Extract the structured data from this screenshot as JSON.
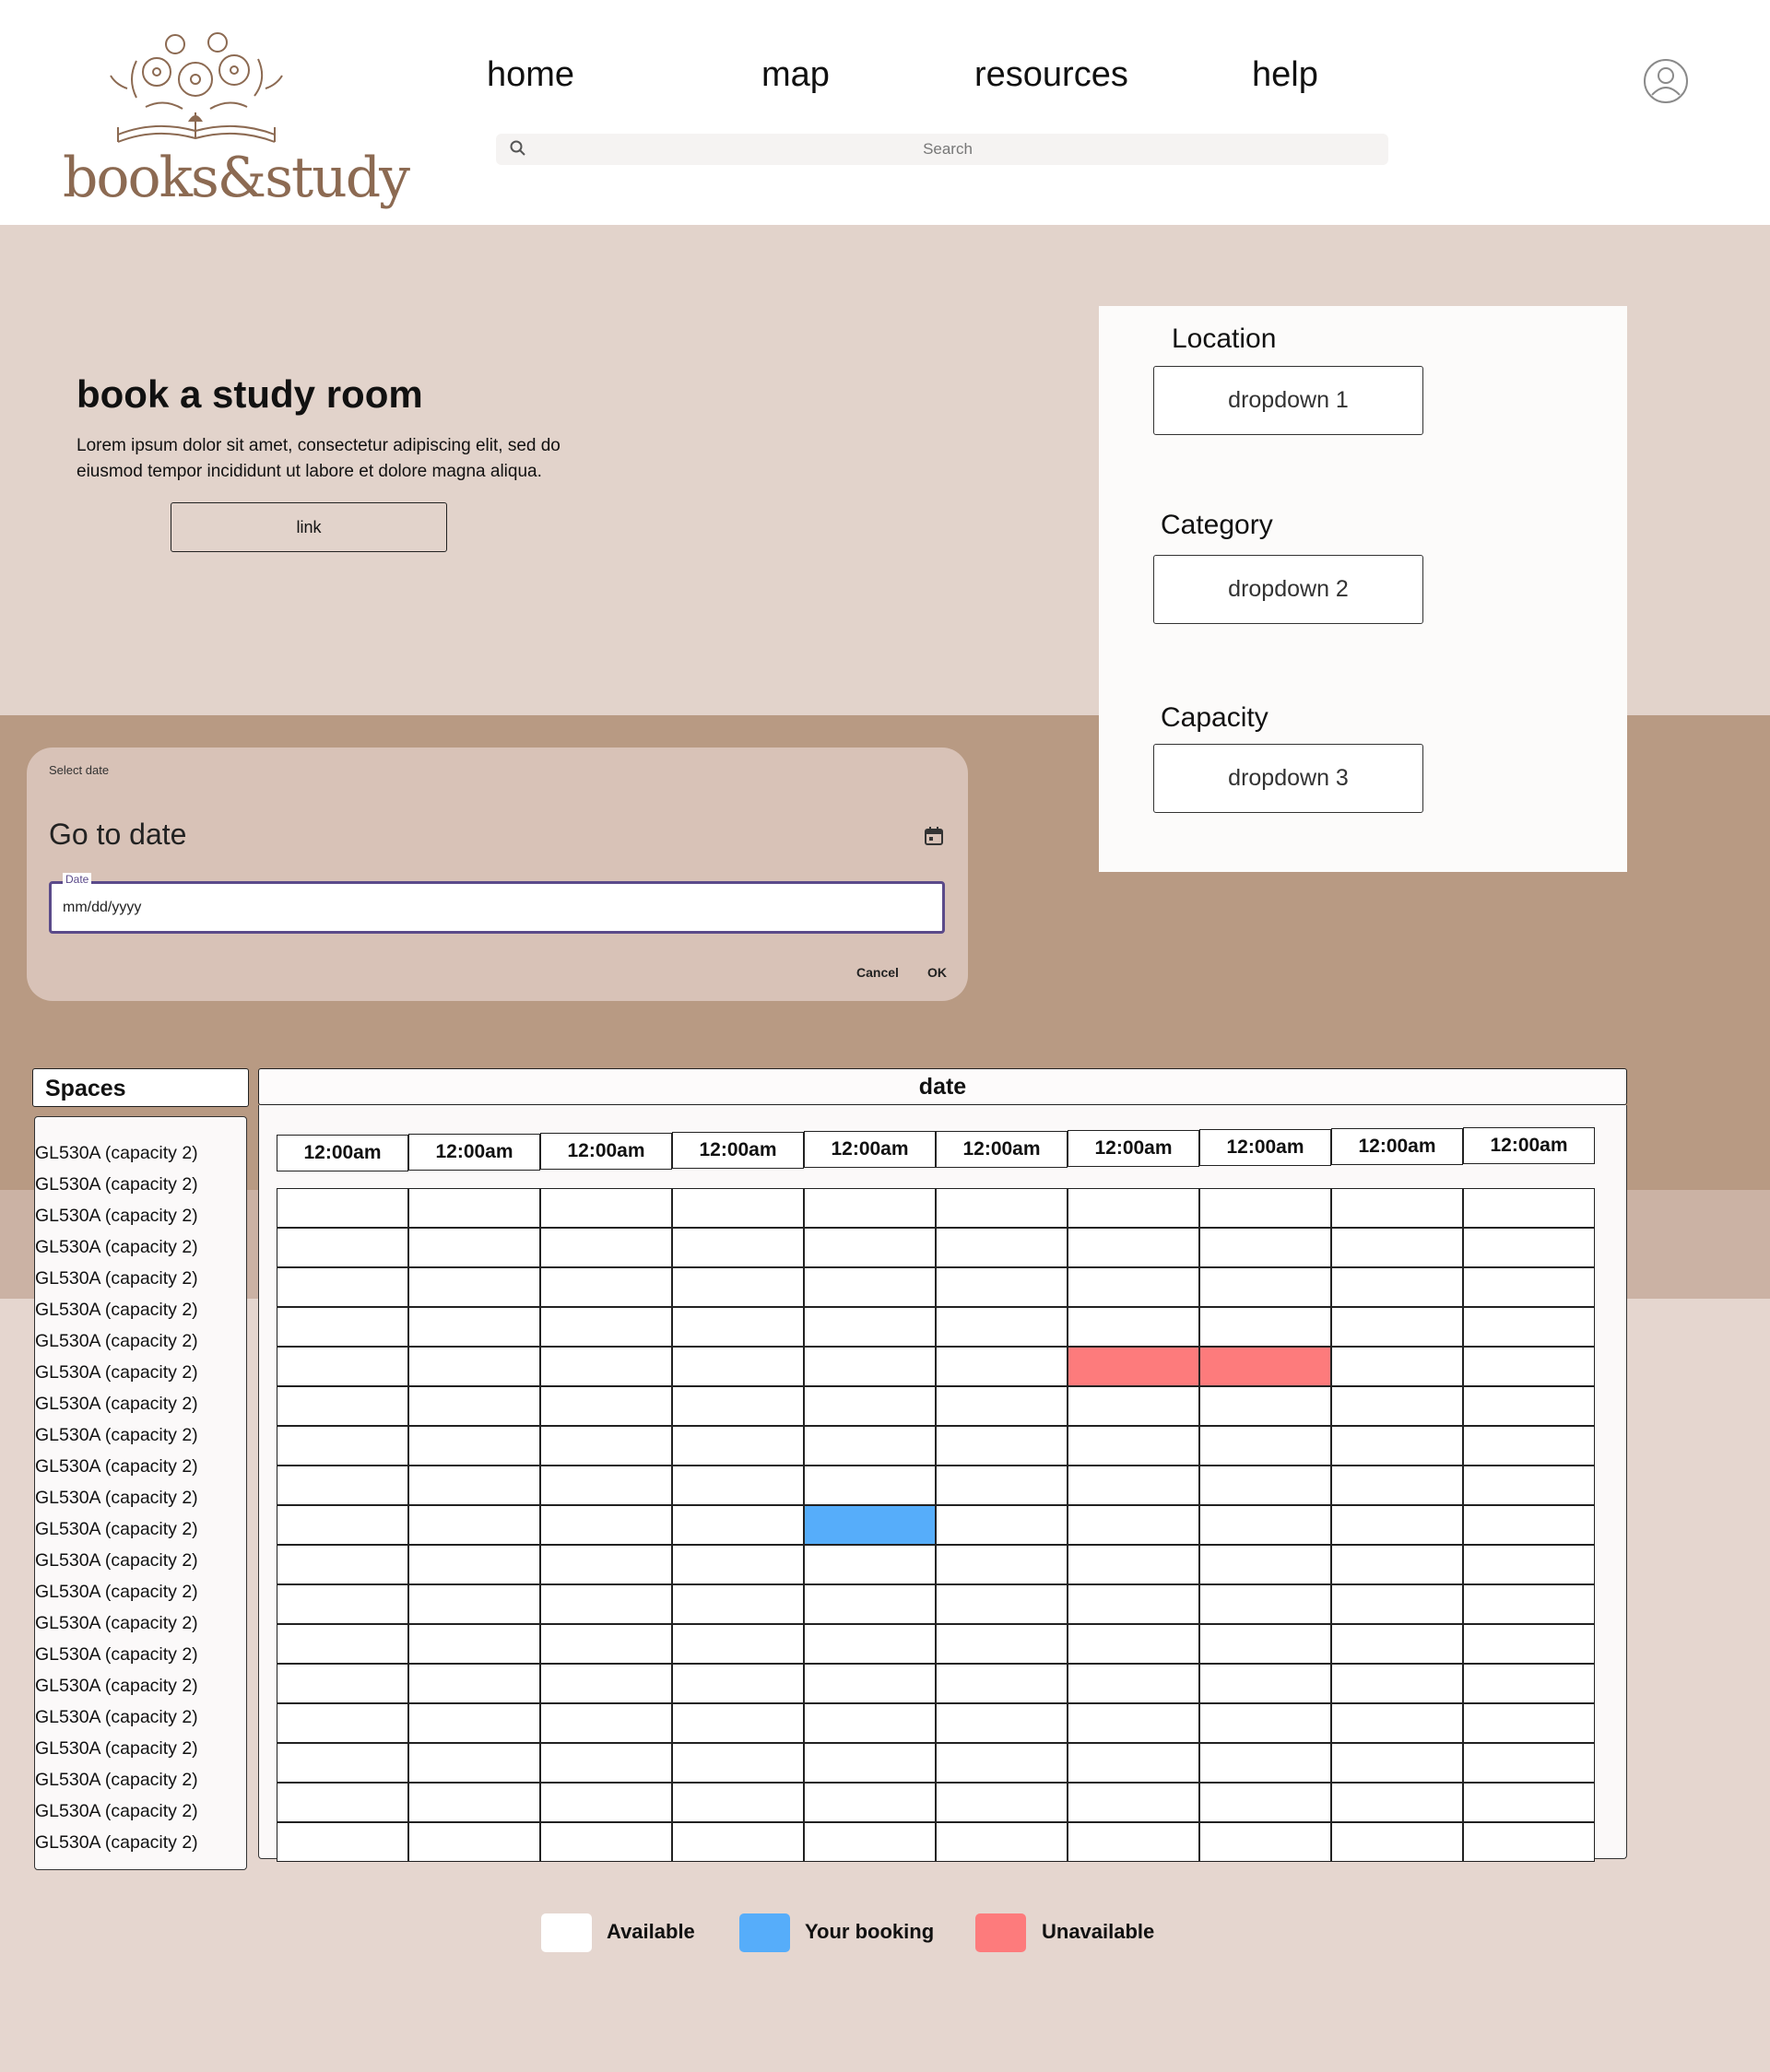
{
  "brand": {
    "name": "books&study"
  },
  "nav": {
    "items": [
      "home",
      "map",
      "resources",
      "help"
    ]
  },
  "search": {
    "placeholder": "Search"
  },
  "hero": {
    "title": "book a study room",
    "body": "Lorem ipsum dolor sit amet, consectetur adipiscing elit, sed do eiusmod tempor incididunt ut labore et dolore magna aliqua.",
    "link_label": "link"
  },
  "filters": {
    "location": {
      "label": "Location",
      "value": "dropdown 1"
    },
    "category": {
      "label": "Category",
      "value": "dropdown 2"
    },
    "capacity": {
      "label": "Capacity",
      "value": "dropdown 3"
    }
  },
  "datepicker": {
    "caption": "Select date",
    "title": "Go to date",
    "field_label": "Date",
    "placeholder": "mm/dd/yyyy",
    "cancel_label": "Cancel",
    "ok_label": "OK"
  },
  "spaces": {
    "header": "Spaces",
    "items": [
      "GL530A (capacity 2)",
      "GL530A (capacity 2)",
      "GL530A (capacity 2)",
      "GL530A (capacity 2)",
      "GL530A (capacity 2)",
      "GL530A (capacity 2)",
      "GL530A (capacity 2)",
      "GL530A (capacity 2)",
      "GL530A (capacity 2)",
      "GL530A (capacity 2)",
      "GL530A (capacity 2)",
      "GL530A (capacity 2)",
      "GL530A (capacity 2)",
      "GL530A (capacity 2)",
      "GL530A (capacity 2)",
      "GL530A (capacity 2)",
      "GL530A (capacity 2)",
      "GL530A (capacity 2)",
      "GL530A (capacity 2)",
      "GL530A (capacity 2)",
      "GL530A (capacity 2)",
      "GL530A (capacity 2)",
      "GL530A (capacity 2)"
    ]
  },
  "schedule": {
    "date_header": "date",
    "time_slots": [
      "12:00am",
      "12:00am",
      "12:00am",
      "12:00am",
      "12:00am",
      "12:00am",
      "12:00am",
      "12:00am",
      "12:00am",
      "12:00am"
    ],
    "row_count": 17,
    "bookings": [
      {
        "row": 4,
        "col": 6,
        "status": "unavailable"
      },
      {
        "row": 4,
        "col": 7,
        "status": "unavailable"
      },
      {
        "row": 8,
        "col": 4,
        "status": "your_booking"
      }
    ]
  },
  "legend": [
    {
      "label": "Available",
      "color": "#ffffff"
    },
    {
      "label": "Your booking",
      "color": "#56adfa"
    },
    {
      "label": "Unavailable",
      "color": "#fd7b7c"
    }
  ],
  "colors": {
    "brand": "#8c6a52",
    "hero_bg": "#e2d3cb",
    "band_dark": "#b89a83",
    "page_bg": "#e5d6cf",
    "accent_field": "#5b4a8a"
  }
}
